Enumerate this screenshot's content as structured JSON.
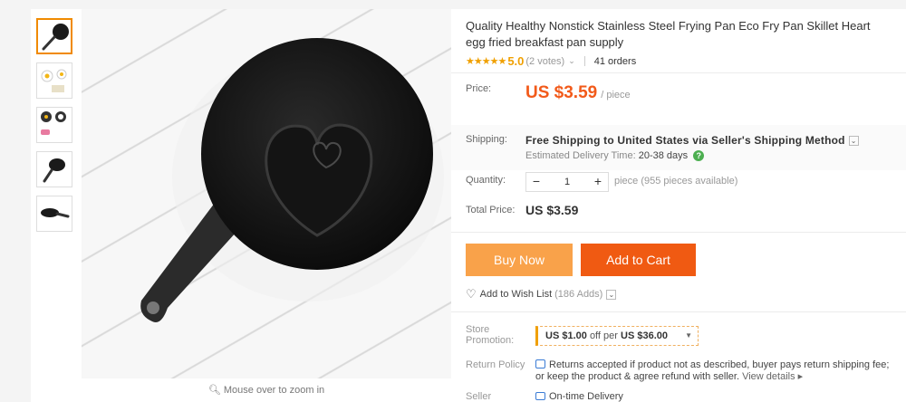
{
  "product": {
    "title": "Quality Healthy Nonstick Stainless Steel Frying Pan Eco Fry Pan Skillet Heart egg fried breakfast pan supply",
    "stars": "★★★★★",
    "rating": "5.0",
    "votes": "(2 votes)",
    "orders": "41 orders"
  },
  "gallery": {
    "zoom_hint": "Mouse over to zoom in",
    "thumb_count": 5,
    "active_index": 0
  },
  "price": {
    "label": "Price:",
    "value": "US $3.59",
    "unit": "/ piece"
  },
  "shipping": {
    "label": "Shipping:",
    "method": "Free Shipping to United States via Seller's Shipping Method",
    "delivery_label": "Estimated Delivery Time:",
    "delivery_value": "20-38 days",
    "help_icon": "?"
  },
  "quantity": {
    "label": "Quantity:",
    "minus": "−",
    "value": "1",
    "plus": "+",
    "stock": "piece (955 pieces available)"
  },
  "total": {
    "label": "Total Price:",
    "value": "US $3.59"
  },
  "actions": {
    "buy_now": "Buy Now",
    "add_to_cart": "Add to Cart",
    "wishlist": "Add to Wish List",
    "wishlist_count": "(186 Adds)"
  },
  "promotion": {
    "label": "Store Promotion:",
    "amount": "US $1.00",
    "off_per": "off per",
    "threshold": "US $36.00"
  },
  "policy": {
    "label": "Return Policy",
    "text": "Returns accepted if product not as described, buyer pays return shipping fee; or keep the product & agree refund with seller.",
    "link": "View details ▸"
  },
  "seller": {
    "label": "Seller",
    "guarantee": "On-time Delivery"
  },
  "colors": {
    "accent_orange": "#f25a1a",
    "buy_now_bg": "#f9a24a",
    "add_to_cart_bg": "#f05a12",
    "star": "#f0a000"
  }
}
